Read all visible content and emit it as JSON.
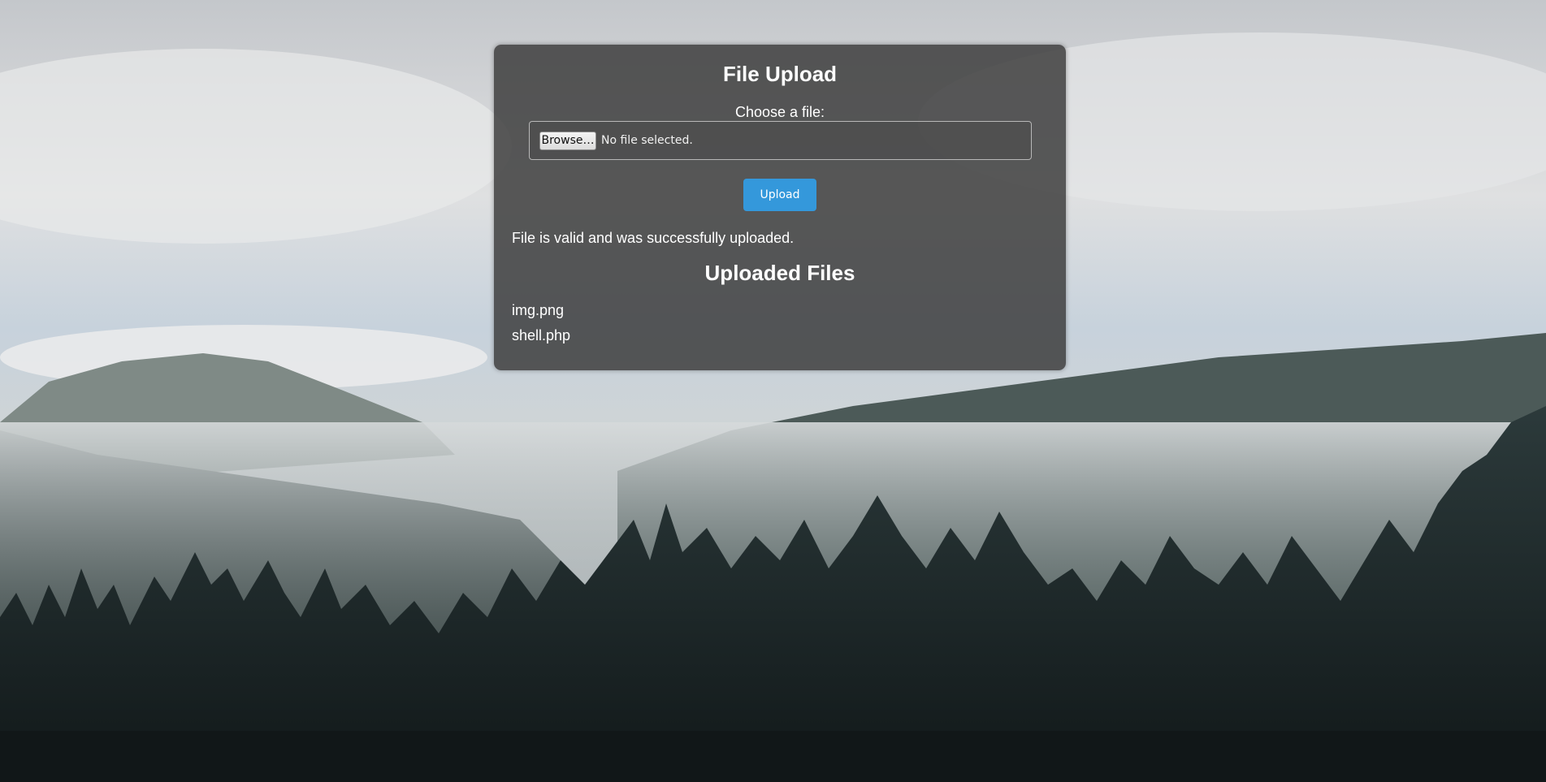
{
  "page": {
    "title": "File Upload"
  },
  "form": {
    "file_label": "Choose a file:",
    "browse_label": "Browse…",
    "file_status": "No file selected.",
    "upload_label": "Upload"
  },
  "message": "File is valid and was successfully uploaded.",
  "uploaded": {
    "heading": "Uploaded Files",
    "files": [
      "img.png",
      "shell.php"
    ]
  },
  "colors": {
    "panel_bg": "#3c3c3c",
    "upload_button": "#3498db",
    "text": "#ffffff"
  }
}
